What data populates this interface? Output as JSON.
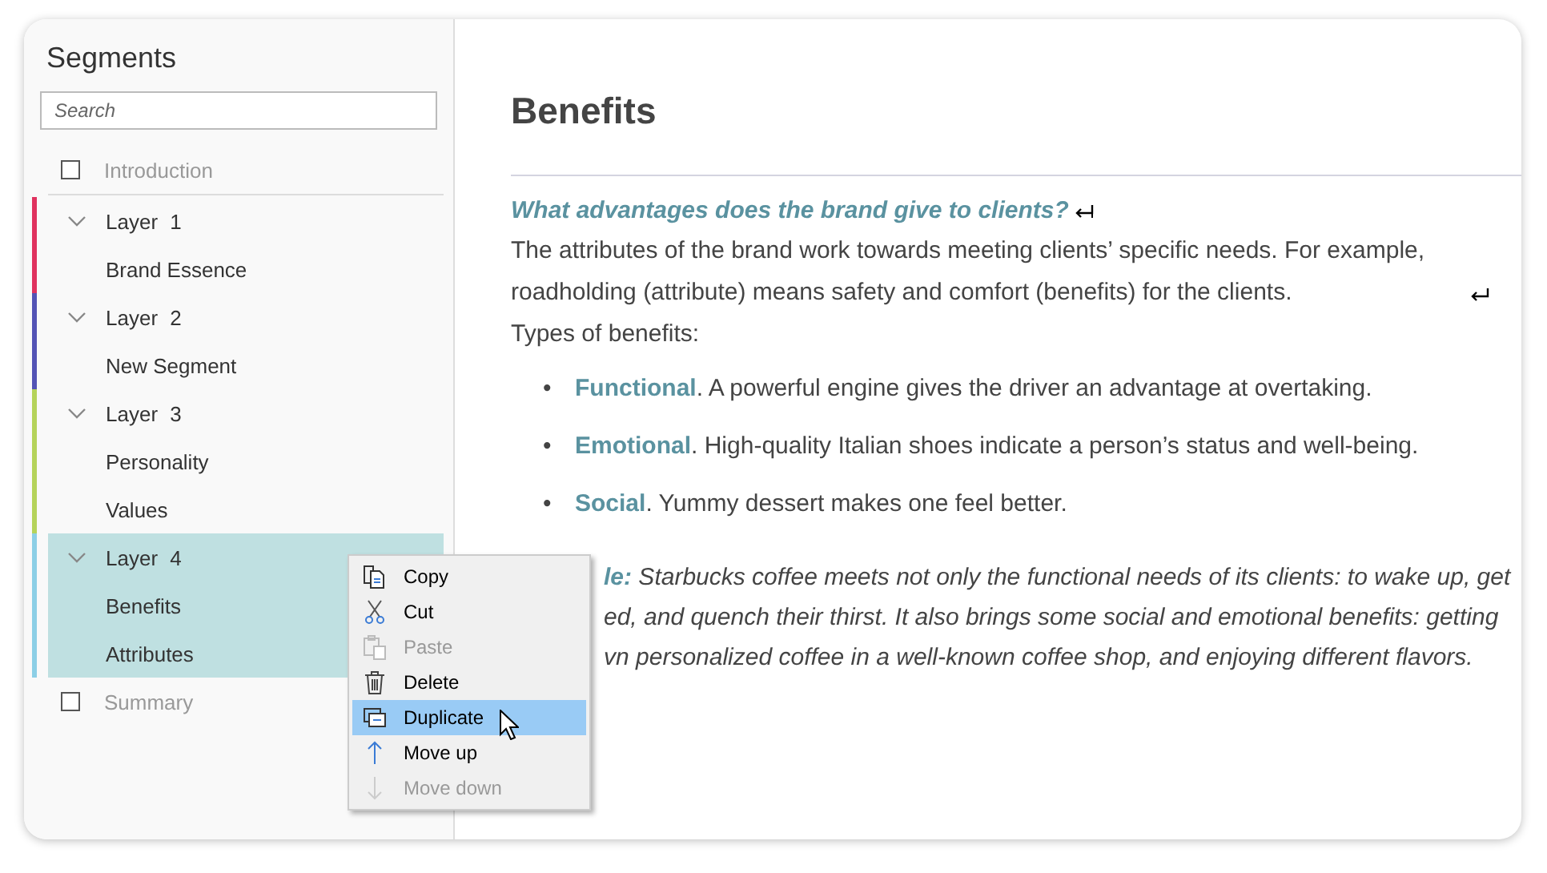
{
  "sidebar": {
    "title": "Segments",
    "search": {
      "placeholder": "Search"
    },
    "sections": [
      {
        "kind": "item",
        "label": "Introduction",
        "checked": false
      },
      {
        "kind": "layer",
        "label": "Layer 1",
        "color": "#e0325f",
        "expanded": true,
        "selected": false,
        "children": [
          {
            "label": "Brand Essence"
          }
        ]
      },
      {
        "kind": "layer",
        "label": "Layer 2",
        "color": "#5353b5",
        "expanded": true,
        "selected": false,
        "children": [
          {
            "label": "New Segment"
          }
        ]
      },
      {
        "kind": "layer",
        "label": "Layer 3",
        "color": "#b5d35a",
        "expanded": true,
        "selected": false,
        "children": [
          {
            "label": "Personality"
          },
          {
            "label": "Values"
          }
        ]
      },
      {
        "kind": "layer",
        "label": "Layer 4",
        "color": "#8ccfe6",
        "expanded": true,
        "selected": true,
        "children": [
          {
            "label": "Benefits"
          },
          {
            "label": "Attributes"
          }
        ]
      },
      {
        "kind": "item",
        "label": "Summary",
        "checked": false
      }
    ]
  },
  "context_menu": {
    "items": [
      {
        "kind": "copy",
        "label": "Copy",
        "disabled": false,
        "selected": false
      },
      {
        "kind": "cut",
        "label": "Cut",
        "disabled": false,
        "selected": false
      },
      {
        "kind": "paste",
        "label": "Paste",
        "disabled": true,
        "selected": false
      },
      {
        "kind": "delete",
        "label": "Delete",
        "disabled": false,
        "selected": false
      },
      {
        "kind": "duplicate",
        "label": "Duplicate",
        "disabled": false,
        "selected": true
      },
      {
        "kind": "up",
        "label": "Move up",
        "disabled": false,
        "selected": false
      },
      {
        "kind": "down",
        "label": "Move down",
        "disabled": true,
        "selected": false
      }
    ]
  },
  "document": {
    "title": "Benefits",
    "question": "What advantages does the brand give to clients?",
    "paragraph": "The attributes of the brand work towards meeting clients’ specific needs. For example, roadholding (attribute) means safety and comfort (benefits) for the clients.",
    "list_intro": "Types of benefits:",
    "bullets": [
      {
        "marker": "•",
        "text": "**Functional**. A powerful engine gives the driver an advantage at overtaking."
      },
      {
        "marker": "•",
        "text": "**Emotional**. High-quality Italian shoes indicate a person’s status and well-being."
      },
      {
        "marker": "•",
        "text": "**Social**. Yummy dessert makes one feel better."
      }
    ],
    "example_lines": [
      "**le:** Starbucks coffee meets not only the functional needs of its clients: to wake up, get",
      "ed, and quench their thirst. It also brings some social and emotional benefits: getting",
      "vn personalized coffee in a well-known coffee shop, and enjoying different flavors."
    ]
  }
}
